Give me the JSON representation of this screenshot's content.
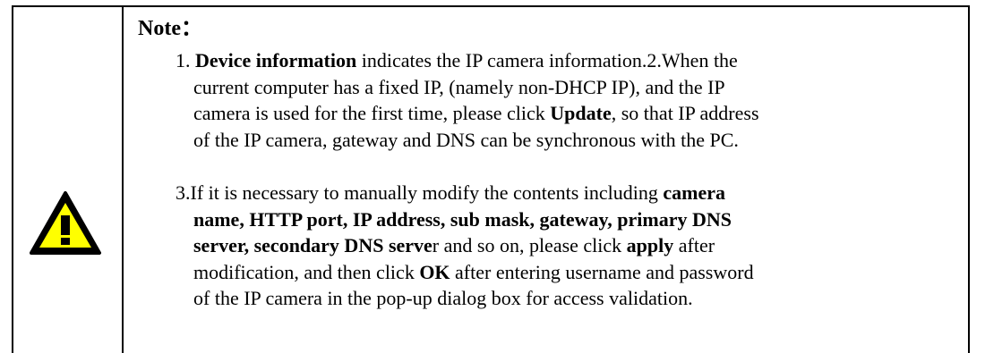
{
  "note": {
    "title": "Note：",
    "icon": "warning-icon",
    "line1": {
      "prefix": "1. ",
      "bold": "Device information",
      "suffix": " indicates the IP camera information.2.When the"
    },
    "line2": "current computer has a fixed IP, (namely non-DHCP IP), and the IP",
    "line3": {
      "prefix": "camera is used for the first time, please click ",
      "bold": "Update",
      "suffix": ", so that IP address"
    },
    "line4": "of the IP camera, gateway and DNS can be synchronous with the PC.",
    "line5": {
      "prefix": "3.If it is necessary to manually modify the contents including ",
      "bold": "camera"
    },
    "line6": {
      "bold": "name, HTTP port, IP address, sub mask, gateway, primary DNS"
    },
    "line7": {
      "bold": "server, secondary DNS serve",
      "suffix": "r and so on, please click ",
      "bold2": "apply",
      "suffix2": " after"
    },
    "line8": {
      "prefix": "modification, and then click ",
      "bold": "OK",
      "suffix": " after entering username and password"
    },
    "line9": "of the IP camera in the pop-up dialog box for access validation.",
    "colors": {
      "icon_fill": "#ffff00",
      "icon_stroke": "#000000"
    }
  }
}
